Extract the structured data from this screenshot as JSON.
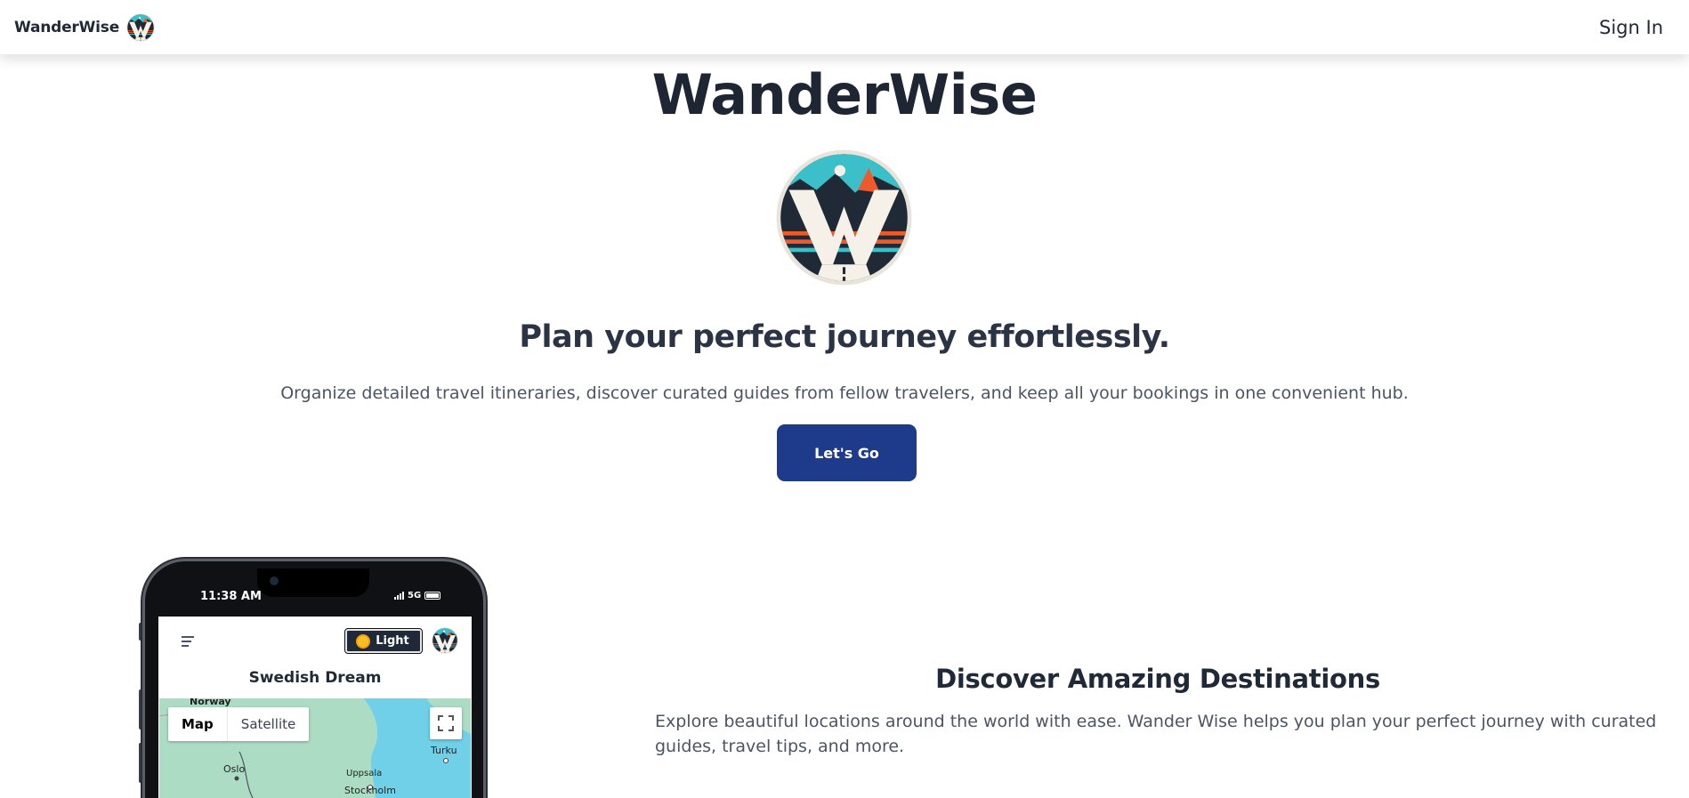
{
  "nav": {
    "brand": "WanderWise",
    "signin": "Sign In"
  },
  "hero": {
    "title": "WanderWise",
    "tagline": "Plan your perfect journey effortlessly.",
    "description": "Organize detailed travel itineraries, discover curated guides from fellow travelers, and keep all your bookings in one convenient hub.",
    "cta": "Let's Go"
  },
  "phone": {
    "status_time": "11:38 AM",
    "network": "5G",
    "theme_toggle": "Light",
    "trip_title": "Swedish Dream",
    "map_tabs": [
      "Map",
      "Satellite"
    ],
    "map_labels": [
      "Norway",
      "Oslo",
      "Uppsala",
      "Stockholm",
      "Turku"
    ]
  },
  "section": {
    "title": "Discover Amazing Destinations",
    "description": "Explore beautiful locations around the world with ease. Wander Wise helps you plan your perfect journey with curated guides, travel tips, and more."
  },
  "colors": {
    "cta_bg": "#1e3a8a",
    "heading": "#1e2533",
    "body_text": "#4b5563",
    "logo_teal": "#3bbfc8",
    "logo_orange": "#ef5a2b",
    "logo_dark": "#1f2a36"
  },
  "icons": [
    "logo-icon",
    "menu-icon",
    "sun-icon",
    "fullscreen-icon"
  ]
}
